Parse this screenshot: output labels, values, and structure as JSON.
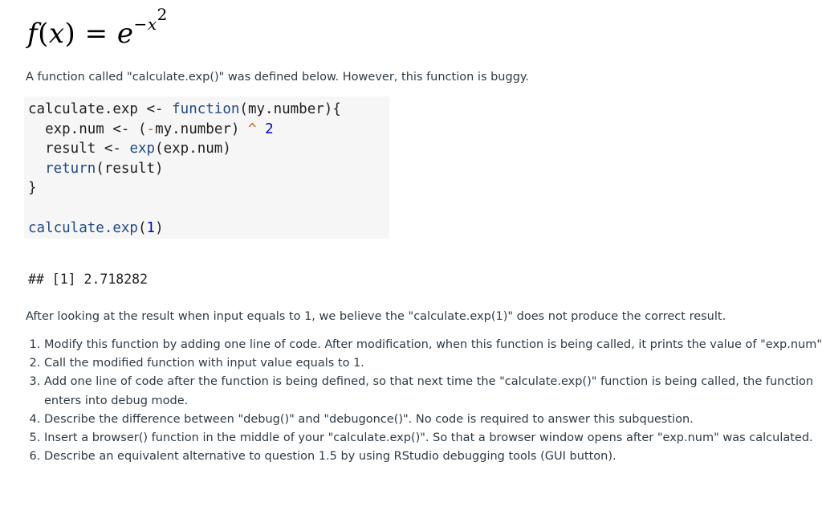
{
  "formula": {
    "lhs_func": "f",
    "lhs_open": "(",
    "lhs_var": "x",
    "lhs_close": ")",
    "equals": " = ",
    "base": "e",
    "exponent_sign": "−",
    "exponent_var": "x",
    "exponent_power": "2"
  },
  "intro_text": "A function called \"calculate.exp()\" was defined below. However, this function is buggy.",
  "code": {
    "lines": [
      [
        {
          "t": "calculate.exp <- ",
          "c": ""
        },
        {
          "t": "function",
          "c": "kw"
        },
        {
          "t": "(my.number){",
          "c": ""
        }
      ],
      [
        {
          "t": "  exp.num <- (",
          "c": ""
        },
        {
          "t": "-",
          "c": "op"
        },
        {
          "t": "my.number) ",
          "c": ""
        },
        {
          "t": "^",
          "c": "op"
        },
        {
          "t": " ",
          "c": ""
        },
        {
          "t": "2",
          "c": "num"
        }
      ],
      [
        {
          "t": "  result <- ",
          "c": ""
        },
        {
          "t": "exp",
          "c": "fn"
        },
        {
          "t": "(exp.num)",
          "c": ""
        }
      ],
      [
        {
          "t": "  ",
          "c": ""
        },
        {
          "t": "return",
          "c": "kw"
        },
        {
          "t": "(result)",
          "c": ""
        }
      ],
      [
        {
          "t": "}",
          "c": ""
        }
      ],
      [
        {
          "t": "",
          "c": ""
        }
      ],
      [
        {
          "t": "calculate.exp",
          "c": "fn"
        },
        {
          "t": "(",
          "c": ""
        },
        {
          "t": "1",
          "c": "num"
        },
        {
          "t": ")",
          "c": ""
        }
      ]
    ]
  },
  "output_text": "## [1] 2.718282",
  "after_text": "After looking at the result when input equals to 1, we believe the \"calculate.exp(1)\" does not produce the correct result.",
  "questions": [
    "Modify this function by adding one line of code. After modification, when this function is being called, it prints the value of \"exp.num\".",
    "Call the modified function with input value equals to 1.",
    "Add one line of code after the function is being defined, so that next time the \"calculate.exp()\" function is being called, the function enters into debug mode.",
    "Describe the difference between \"debug()\" and \"debugonce()\". No code is required to answer this subquestion.",
    "Insert a browser() function in the middle of your \"calculate.exp()\". So that a browser window opens after \"exp.num\" was calculated.",
    "Describe an equivalent alternative to question 1.5 by using RStudio debugging tools (GUI button)."
  ]
}
